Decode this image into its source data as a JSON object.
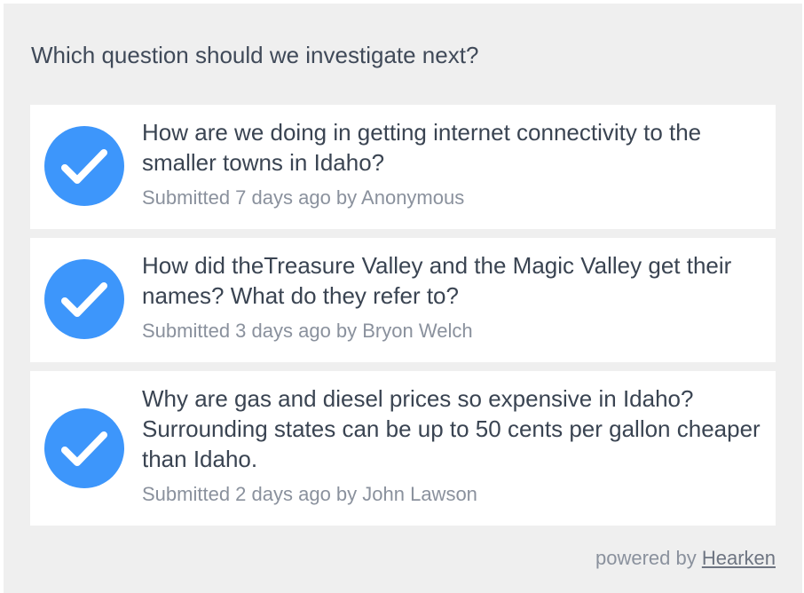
{
  "widget": {
    "prompt": "Which question should we investigate next?",
    "questions": [
      {
        "text": "How are we doing in getting internet connectivity to the smaller towns in Idaho?",
        "meta": "Submitted 7 days ago by Anonymous",
        "icon": "checkmark-circle-icon",
        "selected": true
      },
      {
        "text": "How did theTreasure Valley and the Magic Valley get their names? What do they refer to?",
        "meta": "Submitted 3 days ago by Bryon Welch",
        "icon": "checkmark-circle-icon",
        "selected": true
      },
      {
        "text": "Why are gas and diesel prices so expensive in Idaho? Surrounding states can be up to 50 cents per gallon cheaper than Idaho.",
        "meta": "Submitted 2 days ago by John Lawson",
        "icon": "checkmark-circle-icon",
        "selected": true
      }
    ],
    "footer": {
      "prefix": "powered by",
      "link_label": "Hearken"
    }
  },
  "colors": {
    "background": "#efefef",
    "card": "#ffffff",
    "accent": "#3d96fb",
    "text": "#3a4452",
    "muted": "#8a919d"
  }
}
